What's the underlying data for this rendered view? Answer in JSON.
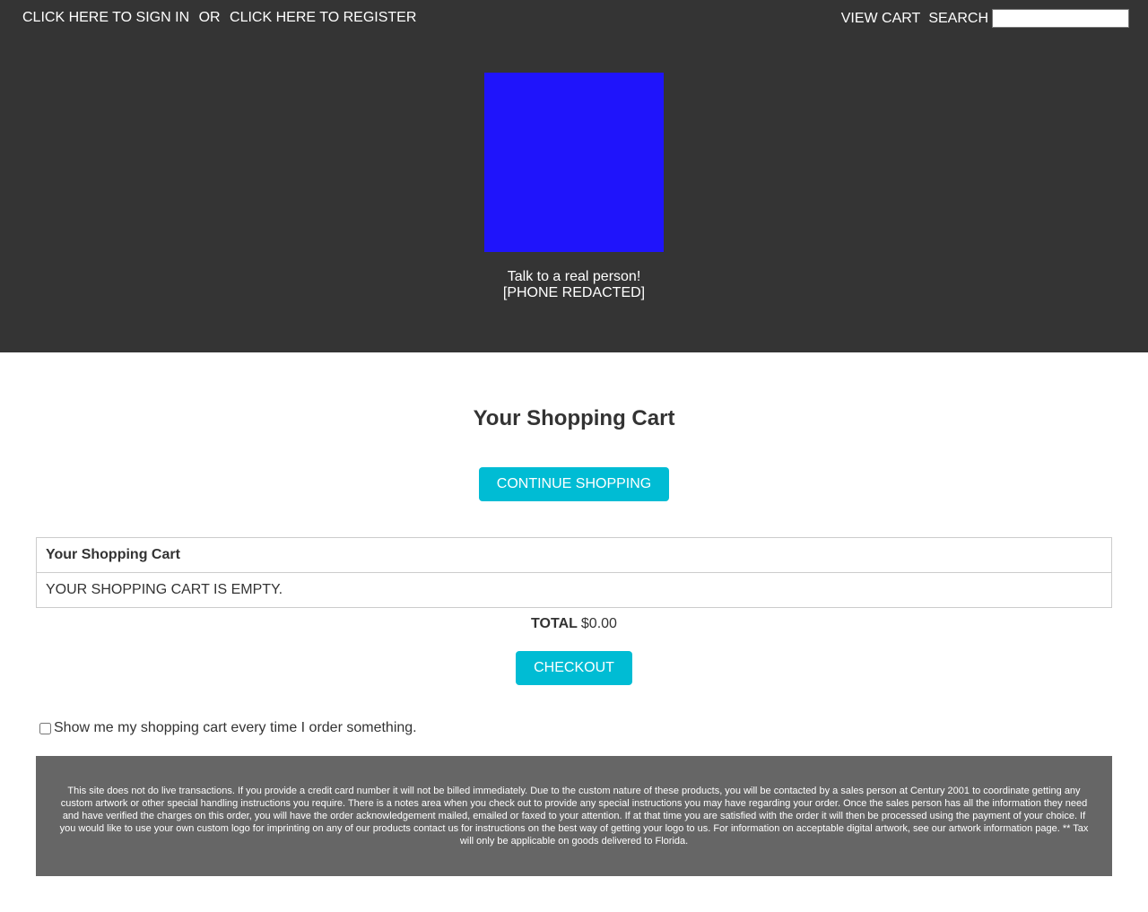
{
  "topbar": {
    "sign_in": "CLICK HERE TO SIGN IN",
    "or": "OR",
    "register": "CLICK HERE TO REGISTER",
    "view_cart": "VIEW CART",
    "search_label": "SEARCH",
    "search_value": ""
  },
  "header": {
    "logo_color": "#1f14fb",
    "contact_line1": "Talk to a real person!",
    "contact_line2": "[PHONE REDACTED]",
    "background": "#343434"
  },
  "main": {
    "title": "Your Shopping Cart",
    "continue_button": "CONTINUE SHOPPING",
    "table": {
      "header": "Your Shopping Cart",
      "empty_message": "YOUR SHOPPING CART IS EMPTY."
    },
    "total_label": "TOTAL",
    "total_value": "$0.00",
    "checkout_button": "CHECKOUT",
    "show_cart_label": "Show me my shopping cart every time I order something.",
    "accent_color": "#00bcd4"
  },
  "footer": {
    "disclaimer": "This site does not do live transactions. If you provide a credit card number it will not be billed immediately. Due to the custom nature of these products, you will be contacted by a sales person at Century 2001 to coordinate getting any custom artwork or other special handling instructions you require. There is a notes area when you check out to provide any special instructions you may have regarding your order. Once the sales person has all the information they need and have verified the charges on this order, you will have the order acknowledgement mailed, emailed or faxed to your attention. If at that time you are satisfied with the order it will then be processed using the payment of your choice. If you would like to use your own custom logo for imprinting on any of our products contact us for instructions on the best way of getting your logo to us. For information on acceptable digital artwork, see our artwork information page. ** Tax will only be applicable on goods delivered to Florida."
  }
}
